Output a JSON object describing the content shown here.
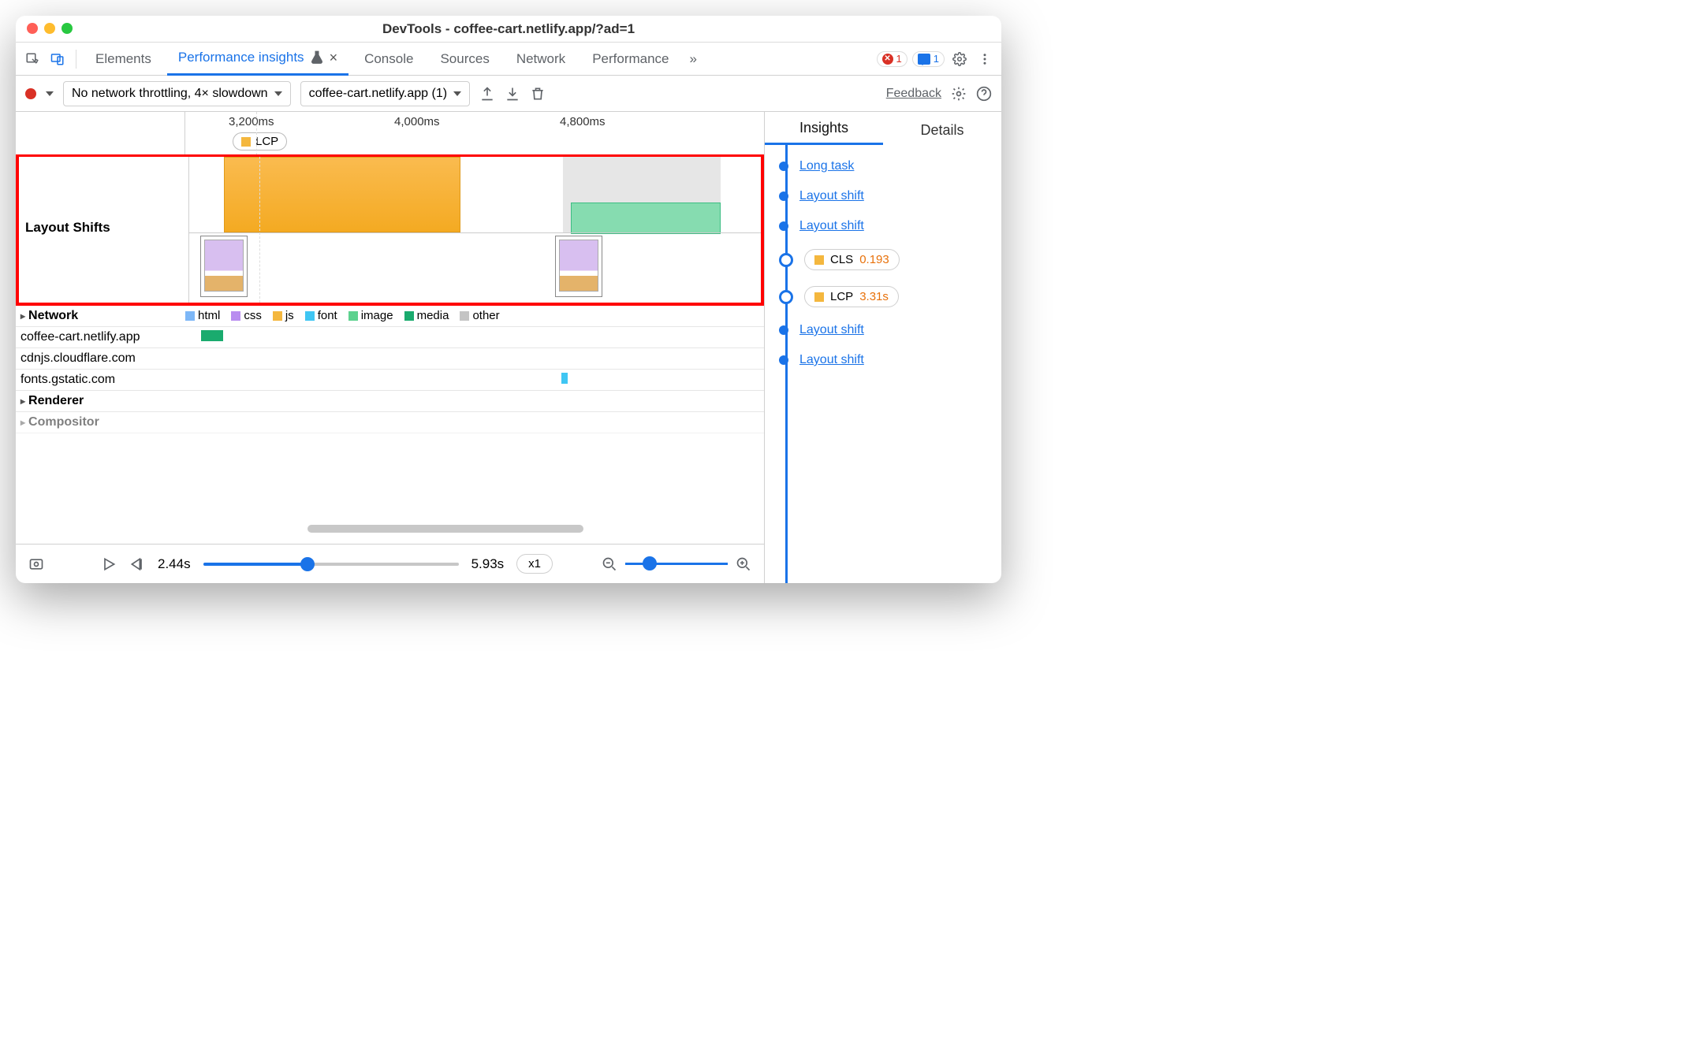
{
  "window": {
    "title": "DevTools - coffee-cart.netlify.app/?ad=1"
  },
  "tabs": {
    "elements": "Elements",
    "performance_insights": "Performance insights",
    "console": "Console",
    "sources": "Sources",
    "network": "Network",
    "performance": "Performance",
    "more_glyph": "»"
  },
  "badges": {
    "errors": "1",
    "messages": "1"
  },
  "toolbar": {
    "throttle": "No network throttling, 4× slowdown",
    "source": "coffee-cart.netlify.app (1)",
    "feedback": "Feedback"
  },
  "ruler": {
    "t1": "3,200ms",
    "t2": "4,000ms",
    "t3": "4,800ms",
    "lcp": "LCP"
  },
  "timeline": {
    "layout_shifts_label": "Layout Shifts",
    "network_label": "Network",
    "renderer_label": "Renderer",
    "compositor_label": "Compositor",
    "legend": {
      "html": "html",
      "css": "css",
      "js": "js",
      "font": "font",
      "image": "image",
      "media": "media",
      "other": "other"
    },
    "hosts": {
      "a": "coffee-cart.netlify.app",
      "b": "cdnjs.cloudflare.com",
      "c": "fonts.gstatic.com"
    }
  },
  "bottom": {
    "start": "2.44s",
    "end": "5.93s",
    "speed": "x1"
  },
  "insights": {
    "tab_insights": "Insights",
    "tab_details": "Details",
    "long_task": "Long task",
    "layout_shift": "Layout shift",
    "cls_label": "CLS",
    "cls_value": "0.193",
    "lcp_label": "LCP",
    "lcp_value": "3.31s"
  },
  "colors": {
    "html": "#7db7f7",
    "css": "#b98df0",
    "js": "#f4b73e",
    "font": "#3fc6f3",
    "image": "#5dd28f",
    "media": "#1aab6e",
    "other": "#c4c4c4",
    "accent": "#1a73e8",
    "lcp": "#f4b73e"
  }
}
